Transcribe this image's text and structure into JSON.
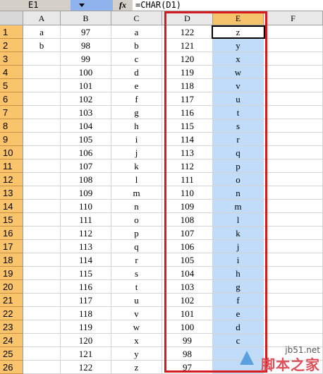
{
  "name_box": "E1",
  "formula": "=CHAR(D1)",
  "fx_label": "fx",
  "columns": [
    "A",
    "B",
    "C",
    "D",
    "E",
    "F"
  ],
  "active_column": "E",
  "rows": [
    {
      "n": "1",
      "A": "a",
      "B": "97",
      "C": "a",
      "D": "122",
      "E": "z"
    },
    {
      "n": "2",
      "A": "b",
      "B": "98",
      "C": "b",
      "D": "121",
      "E": "y"
    },
    {
      "n": "3",
      "A": "",
      "B": "99",
      "C": "c",
      "D": "120",
      "E": "x"
    },
    {
      "n": "4",
      "A": "",
      "B": "100",
      "C": "d",
      "D": "119",
      "E": "w"
    },
    {
      "n": "5",
      "A": "",
      "B": "101",
      "C": "e",
      "D": "118",
      "E": "v"
    },
    {
      "n": "6",
      "A": "",
      "B": "102",
      "C": "f",
      "D": "117",
      "E": "u"
    },
    {
      "n": "7",
      "A": "",
      "B": "103",
      "C": "g",
      "D": "116",
      "E": "t"
    },
    {
      "n": "8",
      "A": "",
      "B": "104",
      "C": "h",
      "D": "115",
      "E": "s"
    },
    {
      "n": "9",
      "A": "",
      "B": "105",
      "C": "i",
      "D": "114",
      "E": "r"
    },
    {
      "n": "10",
      "A": "",
      "B": "106",
      "C": "j",
      "D": "113",
      "E": "q"
    },
    {
      "n": "11",
      "A": "",
      "B": "107",
      "C": "k",
      "D": "112",
      "E": "p"
    },
    {
      "n": "12",
      "A": "",
      "B": "108",
      "C": "l",
      "D": "111",
      "E": "o"
    },
    {
      "n": "13",
      "A": "",
      "B": "109",
      "C": "m",
      "D": "110",
      "E": "n"
    },
    {
      "n": "14",
      "A": "",
      "B": "110",
      "C": "n",
      "D": "109",
      "E": "m"
    },
    {
      "n": "15",
      "A": "",
      "B": "111",
      "C": "o",
      "D": "108",
      "E": "l"
    },
    {
      "n": "16",
      "A": "",
      "B": "112",
      "C": "p",
      "D": "107",
      "E": "k"
    },
    {
      "n": "17",
      "A": "",
      "B": "113",
      "C": "q",
      "D": "106",
      "E": "j"
    },
    {
      "n": "18",
      "A": "",
      "B": "114",
      "C": "r",
      "D": "105",
      "E": "i"
    },
    {
      "n": "19",
      "A": "",
      "B": "115",
      "C": "s",
      "D": "104",
      "E": "h"
    },
    {
      "n": "20",
      "A": "",
      "B": "116",
      "C": "t",
      "D": "103",
      "E": "g"
    },
    {
      "n": "21",
      "A": "",
      "B": "117",
      "C": "u",
      "D": "102",
      "E": "f"
    },
    {
      "n": "22",
      "A": "",
      "B": "118",
      "C": "v",
      "D": "101",
      "E": "e"
    },
    {
      "n": "23",
      "A": "",
      "B": "119",
      "C": "w",
      "D": "100",
      "E": "d"
    },
    {
      "n": "24",
      "A": "",
      "B": "120",
      "C": "x",
      "D": "99",
      "E": "c"
    },
    {
      "n": "25",
      "A": "",
      "B": "121",
      "C": "y",
      "D": "98",
      "E": ""
    },
    {
      "n": "26",
      "A": "",
      "B": "122",
      "C": "z",
      "D": "97",
      "E": ""
    }
  ],
  "watermark": {
    "site": "jb51.net",
    "name": "脚本之家"
  },
  "colors": {
    "row_header": "#f9c46b",
    "selection": "#c0dcf8",
    "highlight_box": "#d71920"
  }
}
